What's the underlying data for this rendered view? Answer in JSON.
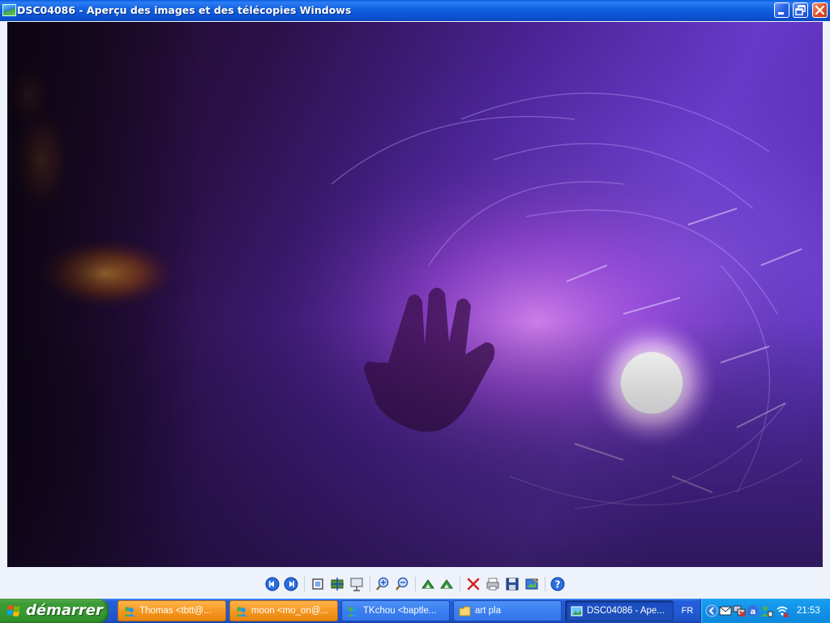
{
  "window": {
    "title": "DSC04086 - Aperçu des images et des télécopies Windows"
  },
  "toolbar": {
    "buttons": [
      "previous-image",
      "next-image",
      "best-fit",
      "actual-size",
      "slide-show",
      "zoom-in",
      "zoom-out",
      "rotate-clockwise",
      "rotate-counterclockwise",
      "delete",
      "print",
      "copy-to",
      "open-for-editing",
      "help"
    ]
  },
  "taskbar": {
    "start_label": "démarrer",
    "tasks": [
      {
        "label": "Thomas <tbtt@...",
        "icon": "messenger-icon",
        "state": "flash"
      },
      {
        "label": "moon <mo_on@...",
        "icon": "messenger-icon",
        "state": "flash"
      },
      {
        "label": "TKchou <baptle...",
        "icon": "messenger-icon",
        "state": "normal"
      },
      {
        "label": "art pla",
        "icon": "folder-icon",
        "state": "normal"
      },
      {
        "label": "DSC04086 - Ape...",
        "icon": "image-viewer-icon",
        "state": "active"
      }
    ],
    "language": "FR",
    "clock": "21:53"
  },
  "colors": {
    "titlebar": "#1160e0",
    "taskbar": "#225bd6",
    "start_button": "#379a31",
    "tray": "#1192e8",
    "photo_purple": "#7a3fd8"
  }
}
